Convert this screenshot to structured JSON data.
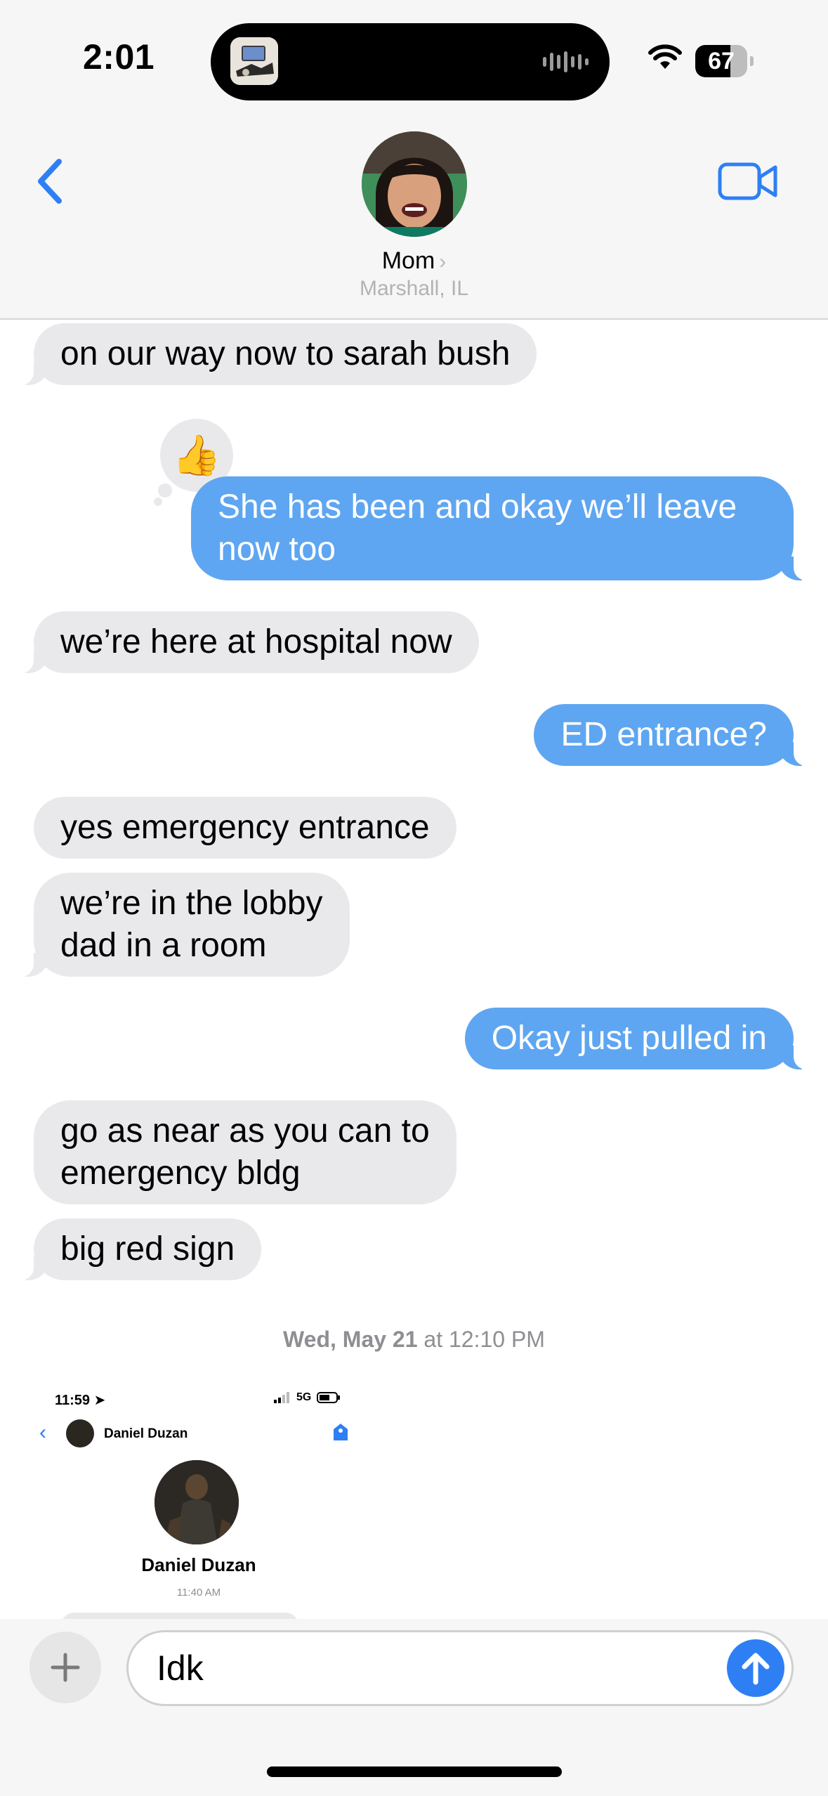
{
  "status_bar": {
    "time": "2:01",
    "battery": "67",
    "battery_level": 0.67
  },
  "header": {
    "contact_name": "Mom",
    "location": "Marshall, IL"
  },
  "messages": [
    {
      "text": "on our way now to sarah bush"
    },
    {
      "text": "She has been and okay we’ll leave\nnow too",
      "reaction": "👍"
    },
    {
      "text": "we’re here at hospital now"
    },
    {
      "text": "ED entrance?"
    },
    {
      "text": "yes emergency entrance"
    },
    {
      "text": "we’re in the lobby\ndad in a room"
    },
    {
      "text": "Okay just pulled in"
    },
    {
      "text": "go as near as you can to\nemergency bldg"
    },
    {
      "text": "big red sign"
    }
  ],
  "timestamp": {
    "day": "Wed, May 21",
    "time": "at 12:10 PM"
  },
  "attachment": {
    "time": "11:59",
    "network": "5G",
    "contact_small": "Daniel Duzan",
    "contact_big": "Daniel Duzan",
    "message_time": "11:40 AM"
  },
  "compose": {
    "text": "Idk"
  },
  "colors": {
    "accent": "#2f7ff4",
    "outgoing_bubble": "#5ea6f1",
    "incoming_bubble": "#e9e9eb"
  }
}
